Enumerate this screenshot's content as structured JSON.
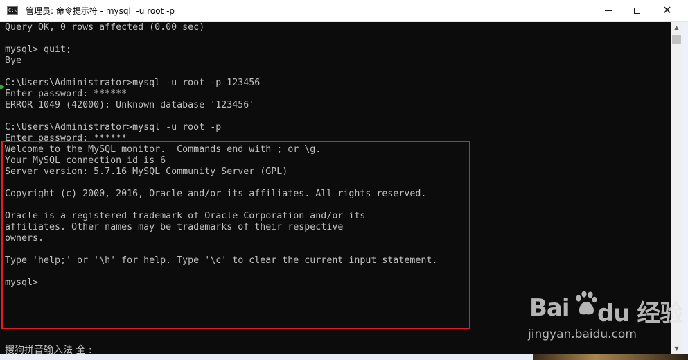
{
  "window": {
    "title": "管理员: 命令提示符 - mysql  -u root -p",
    "icon_text": "C:\\"
  },
  "console": {
    "lines": [
      "Query OK, 0 rows affected (0.00 sec)",
      "",
      "mysql> quit;",
      "Bye",
      "",
      "C:\\Users\\Administrator>mysql -u root -p 123456",
      "Enter password: ******",
      "ERROR 1049 (42000): Unknown database '123456'",
      "",
      "C:\\Users\\Administrator>mysql -u root -p",
      "Enter password: ******",
      "Welcome to the MySQL monitor.  Commands end with ; or \\g.",
      "Your MySQL connection id is 6",
      "Server version: 5.7.16 MySQL Community Server (GPL)",
      "",
      "Copyright (c) 2000, 2016, Oracle and/or its affiliates. All rights reserved.",
      "",
      "Oracle is a registered trademark of Oracle Corporation and/or its",
      "affiliates. Other names may be trademarks of their respective",
      "owners.",
      "",
      "Type 'help;' or '\\h' for help. Type '\\c' to clear the current input statement.",
      "",
      "mysql>"
    ]
  },
  "ime": {
    "status": "搜狗拼音输入法 全 :"
  },
  "watermark": {
    "brand_left": "Bai",
    "brand_right": "du 经验",
    "url": "jingyan.baidu.com"
  },
  "colors": {
    "console_bg": "#0c0c0c",
    "console_text": "#c0c0c0",
    "highlight": "#e11d1d"
  }
}
